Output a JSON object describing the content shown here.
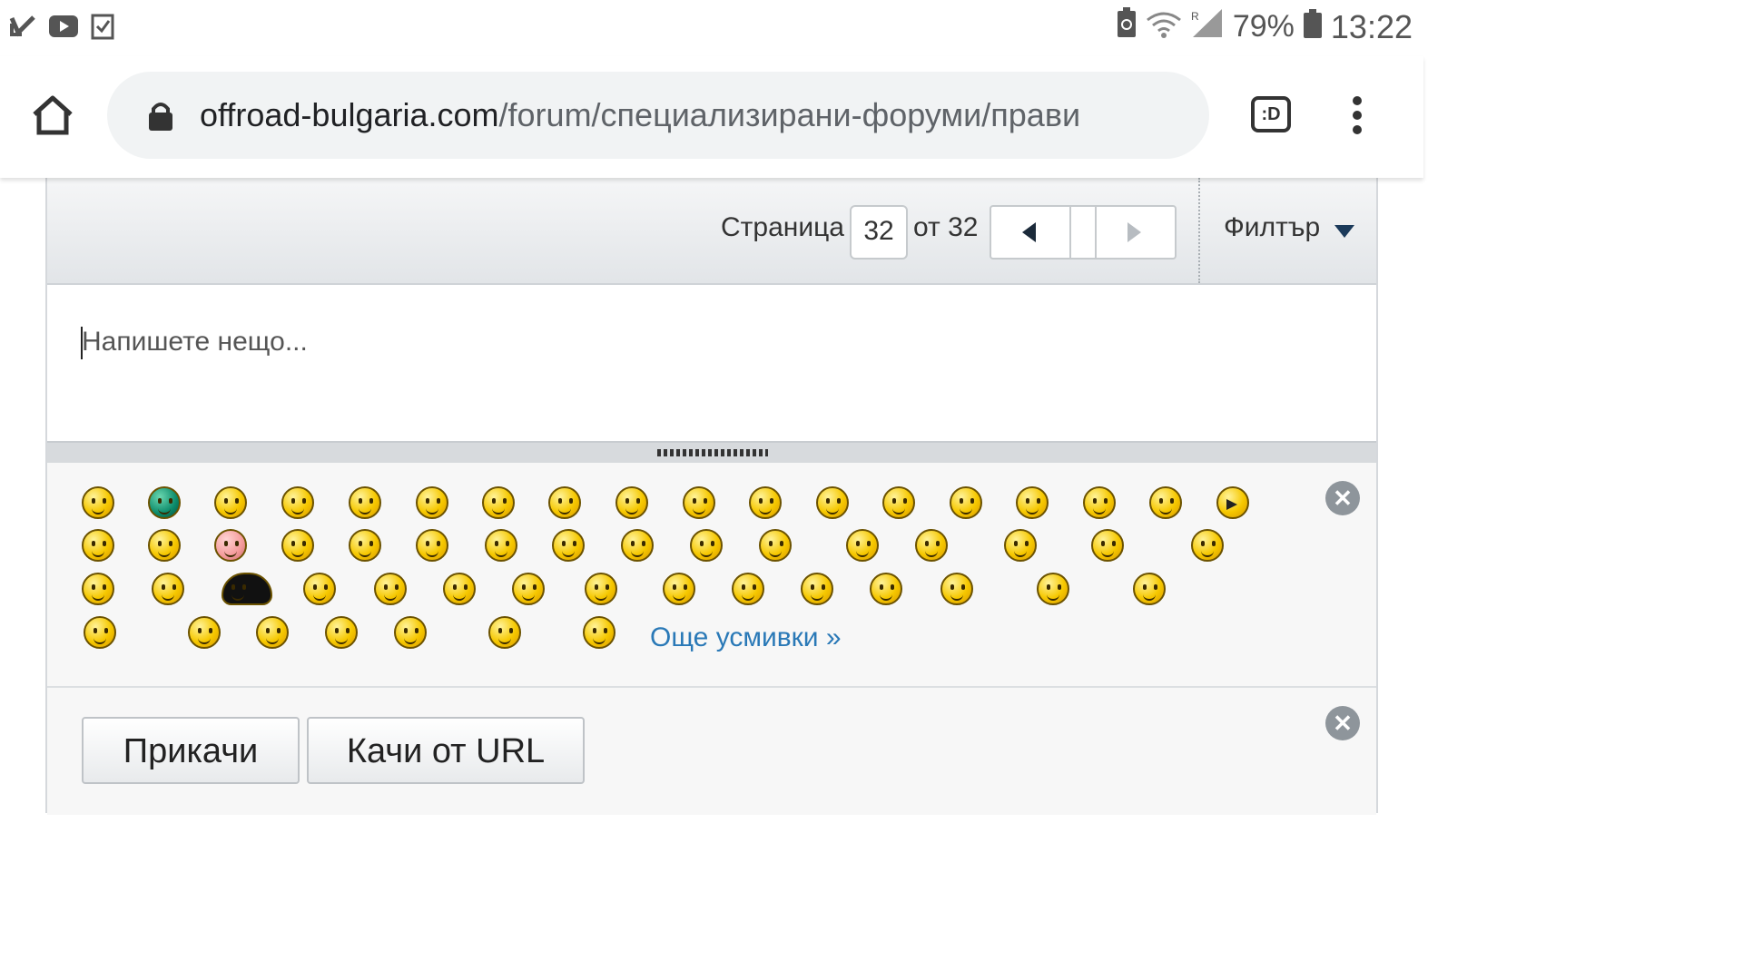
{
  "status_bar": {
    "left_icons": [
      "check-notification-icon",
      "youtube-icon",
      "task-icon"
    ],
    "right_icons": [
      "battery-saver-icon",
      "wifi-icon",
      "signal-icon",
      "battery-icon"
    ],
    "battery_percent": "79%",
    "time": "13:22"
  },
  "browser": {
    "url_domain": "offroad-bulgaria.com",
    "url_path": "/forum/специализирани-форуми/прави",
    "tab_switcher_label": ":D"
  },
  "forum": {
    "pagination": {
      "page_label": "Страница",
      "current_page": "32",
      "of_label": "от 32"
    },
    "filter_label": "Филтър",
    "editor": {
      "placeholder": "Напишете нещо..."
    },
    "smilies": {
      "more_link": "Още усмивки »",
      "close_symbol": "✕"
    },
    "attachments": {
      "attach_button": "Прикачи",
      "upload_url_button": "Качи от URL",
      "close_symbol": "✕"
    }
  }
}
